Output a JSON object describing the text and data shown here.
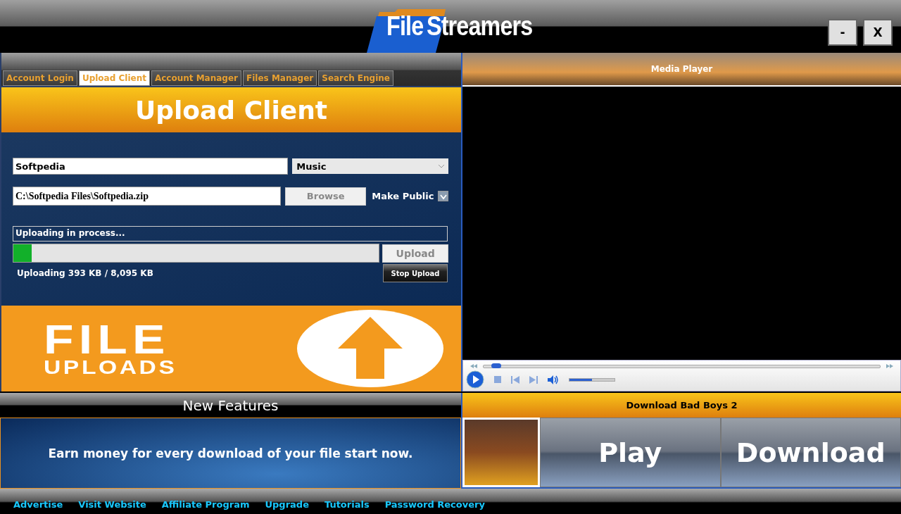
{
  "app": {
    "logo_word_1": "File",
    "logo_word_2": "Streamers",
    "window_buttons": [
      "-",
      "X"
    ]
  },
  "tabs": [
    {
      "label": "Account Login",
      "selected": false
    },
    {
      "label": "Upload Client",
      "selected": true
    },
    {
      "label": "Account Manager",
      "selected": false
    },
    {
      "label": "Files Manager",
      "selected": false
    },
    {
      "label": "Search Engine",
      "selected": false
    }
  ],
  "upload": {
    "title": "Upload Client",
    "name_value": "Softpedia",
    "category": "Music",
    "path_value": "C:\\Softpedia Files\\Softpedia.zip",
    "browse": "Browse",
    "make_public_label": "Make Public",
    "make_public_checked": true,
    "status": "Uploading in process...",
    "level": 0.05,
    "upload_button": "Upload",
    "progress_text": "Uploading 393 KB / 8,095 KB",
    "stop_button": "Stop Upload"
  },
  "banner": {
    "line_1": "FILE",
    "line_2": "UPLOADS"
  },
  "media_player": {
    "title": "Media Player",
    "seek": {
      "level": 0.02
    },
    "volume": {
      "level": 0.5
    }
  },
  "features": {
    "title": "New Features",
    "message": "Earn money for every download of your file start now."
  },
  "download": {
    "title": "Download Bad Boys 2",
    "play": "Play",
    "download": "Download"
  },
  "footer_links": [
    "Advertise",
    "Visit Website",
    "Affiliate Program",
    "Upgrade",
    "Tutorials",
    "Password Recovery"
  ]
}
